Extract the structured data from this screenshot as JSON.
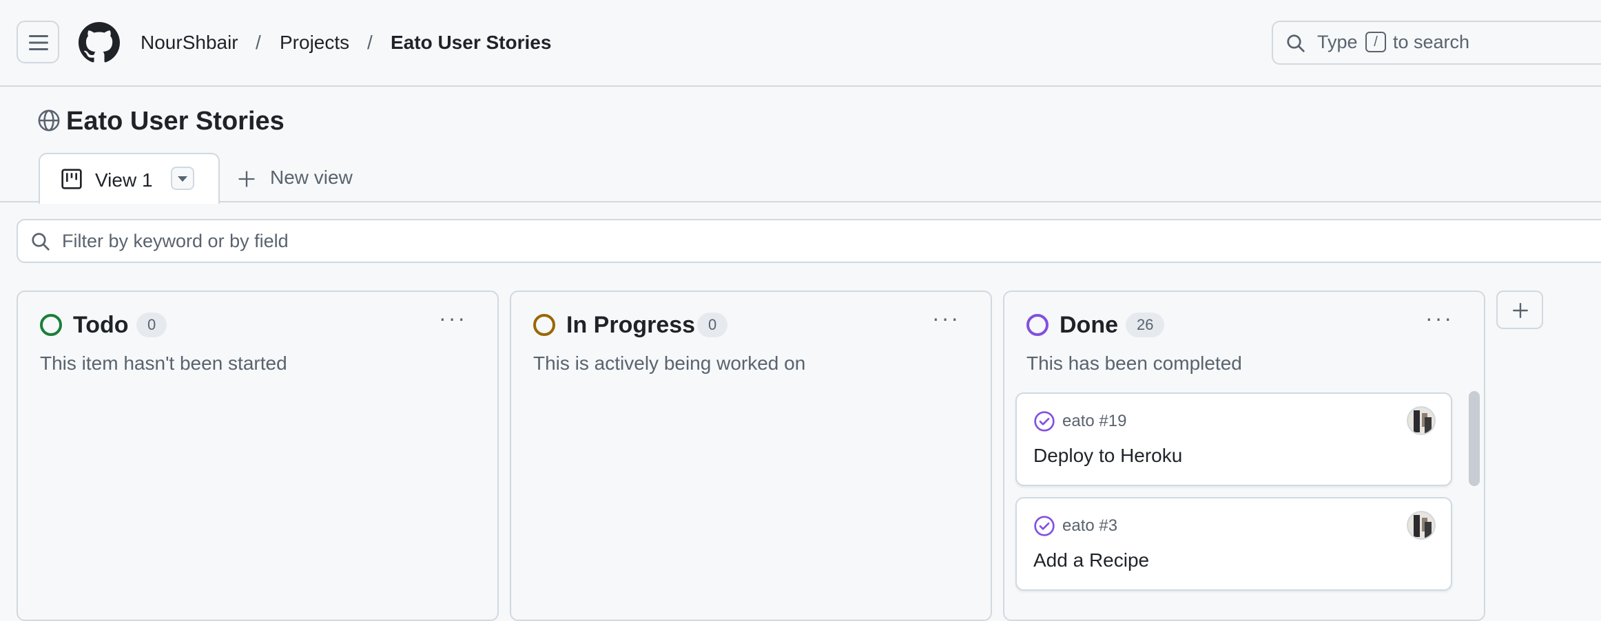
{
  "header": {
    "breadcrumbs": [
      "NourShbair",
      "Projects",
      "Eato User Stories"
    ],
    "separator": "/",
    "search": {
      "prefix": "Type",
      "key": "/",
      "suffix": "to search"
    }
  },
  "project": {
    "title": "Eato User Stories"
  },
  "tabs": [
    {
      "label": "View 1",
      "active": true
    }
  ],
  "new_view_label": "New view",
  "filter": {
    "placeholder": "Filter by keyword or by field"
  },
  "columns": [
    {
      "name": "Todo",
      "count": "0",
      "description": "This item hasn't been started",
      "color": "#1a7f37"
    },
    {
      "name": "In Progress",
      "count": "0",
      "description": "This is actively being worked on",
      "color": "#9a6700"
    },
    {
      "name": "Done",
      "count": "26",
      "description": "This has been completed",
      "color": "#8250df",
      "cards": [
        {
          "ref": "eato #19",
          "title": "Deploy to Heroku"
        },
        {
          "ref": "eato #3",
          "title": "Add a Recipe"
        }
      ]
    }
  ],
  "colors": {
    "done": "#8250df",
    "border": "#d1d9e0",
    "muted": "#59636e",
    "bg": "#f6f8fa"
  }
}
